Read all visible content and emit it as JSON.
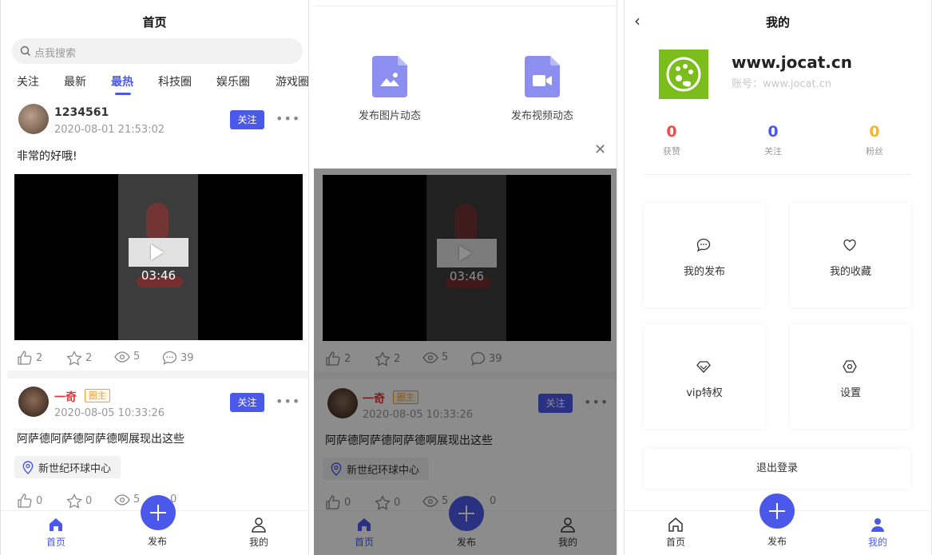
{
  "home": {
    "title": "首页",
    "search_placeholder": "点我搜索",
    "tabs": [
      "关注",
      "最新",
      "最热",
      "科技圈",
      "娱乐圈",
      "游戏圈"
    ],
    "active_tab": "最热",
    "posts": [
      {
        "username": "1234561",
        "time": "2020-08-01 21:53:02",
        "follow_label": "关注",
        "text": "非常的好哦!",
        "video_duration": "03:46",
        "likes": "2",
        "stars": "2",
        "views": "5",
        "comments": "39"
      },
      {
        "username": "一奇",
        "badge": "圈主",
        "time": "2020-08-05 10:33:26",
        "follow_label": "关注",
        "text": "阿萨德阿萨德阿萨德啊展现出这些",
        "location": "新世纪环球中心",
        "likes": "0",
        "stars": "0",
        "views": "5",
        "comments": "0"
      }
    ]
  },
  "publish_sheet": {
    "image_label": "发布图片动态",
    "video_label": "发布视频动态"
  },
  "tabbar": {
    "home": "首页",
    "publish": "发布",
    "mine": "我的"
  },
  "profile": {
    "title": "我的",
    "name": "www.jocat.cn",
    "account": "账号：www.jocat.cn",
    "stats": [
      {
        "value": "0",
        "label": "获赞",
        "color": "#f24b4b"
      },
      {
        "value": "0",
        "label": "关注",
        "color": "#4b59ea"
      },
      {
        "value": "0",
        "label": "粉丝",
        "color": "#f5b729"
      }
    ],
    "menu": [
      "我的发布",
      "我的收藏",
      "vip特权",
      "设置"
    ],
    "logout": "退出登录"
  },
  "colors": {
    "accent": "#4b59ea",
    "logo_green": "#7cbd1e",
    "badge_orange": "#f0a13a"
  }
}
